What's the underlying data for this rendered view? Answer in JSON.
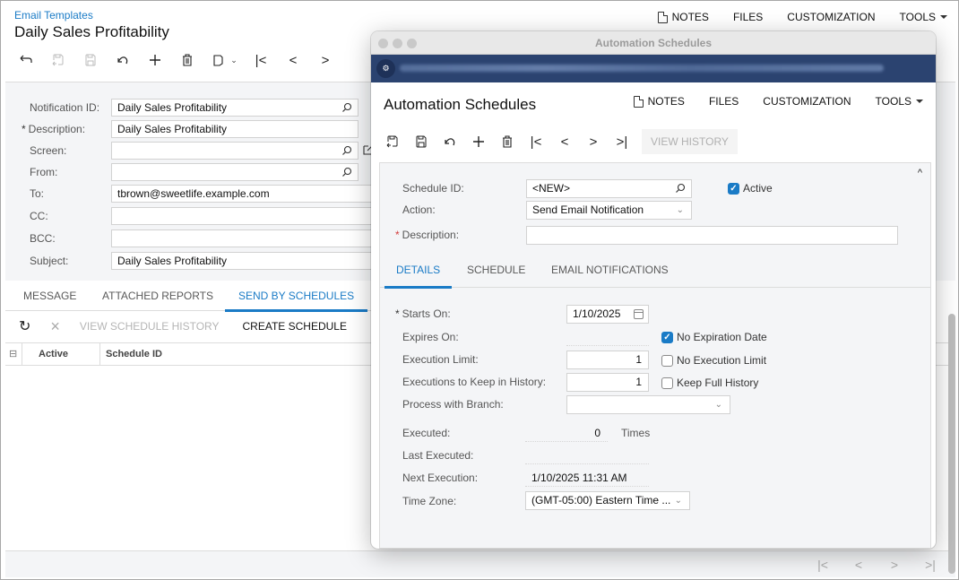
{
  "main": {
    "breadcrumb": "Email Templates",
    "title": "Daily Sales Profitability",
    "top_links": {
      "notes": "NOTES",
      "files": "FILES",
      "customization": "CUSTOMIZATION",
      "tools": "TOOLS"
    },
    "toolbar": [
      {
        "icon": "back-icon",
        "glyph": "↩",
        "disabled": false
      },
      {
        "icon": "save-close-icon",
        "disabled": true
      },
      {
        "icon": "save-icon",
        "disabled": true
      },
      {
        "icon": "undo-icon",
        "glyph": "↶",
        "disabled": false
      },
      {
        "icon": "add-icon",
        "glyph": "+",
        "disabled": false
      },
      {
        "icon": "delete-icon",
        "disabled": false
      },
      {
        "icon": "copy-paste-icon",
        "disabled": false
      },
      {
        "icon": "first-record-icon",
        "glyph": "|<",
        "disabled": false
      },
      {
        "icon": "previous-record-icon",
        "glyph": "<",
        "disabled": false
      },
      {
        "icon": "next-record-icon",
        "glyph": ">",
        "disabled": false
      }
    ],
    "form": {
      "notification_id": {
        "label": "Notification ID:",
        "value": "Daily Sales Profitability"
      },
      "description": {
        "label": "Description:",
        "value": "Daily Sales Profitability",
        "required": "*"
      },
      "screen": {
        "label": "Screen:",
        "value": ""
      },
      "from": {
        "label": "From:",
        "value": ""
      },
      "to": {
        "label": "To:",
        "value": "tbrown@sweetlife.example.com"
      },
      "cc": {
        "label": "CC:",
        "value": ""
      },
      "bcc": {
        "label": "BCC:",
        "value": ""
      },
      "subject": {
        "label": "Subject:",
        "value": "Daily Sales Profitability"
      }
    },
    "tabs": [
      "MESSAGE",
      "ATTACHED REPORTS",
      "SEND BY SCHEDULES"
    ],
    "active_tab": "SEND BY SCHEDULES",
    "grid_toolbar": {
      "refresh": "↻",
      "delete": "×",
      "view_schedule_history": "VIEW SCHEDULE HISTORY",
      "create_schedule": "CREATE SCHEDULE"
    },
    "grid_columns": [
      "Active",
      "Schedule ID"
    ],
    "pager": [
      "|<",
      "<",
      ">",
      ">|"
    ]
  },
  "popup": {
    "window_title": "Automation Schedules",
    "page_title": "Automation Schedules",
    "top_links": {
      "notes": "NOTES",
      "files": "FILES",
      "customization": "CUSTOMIZATION",
      "tools": "TOOLS"
    },
    "toolbar": {
      "view_history": "VIEW HISTORY"
    },
    "form": {
      "schedule_id": {
        "label": "Schedule ID:",
        "value": "<NEW>"
      },
      "active": {
        "label": "Active",
        "checked": true
      },
      "action": {
        "label": "Action:",
        "value": "Send Email Notification"
      },
      "description": {
        "label": "Description:",
        "value": "",
        "required": "*"
      }
    },
    "tabs": [
      "DETAILS",
      "SCHEDULE",
      "EMAIL NOTIFICATIONS"
    ],
    "active_tab": "DETAILS",
    "details": {
      "starts_on": {
        "label": "Starts On:",
        "value": "1/10/2025",
        "required": "*"
      },
      "expires_on": {
        "label": "Expires On:",
        "value": ""
      },
      "no_expiration_date": {
        "label": "No Expiration Date",
        "checked": true
      },
      "execution_limit": {
        "label": "Execution Limit:",
        "value": "1"
      },
      "no_execution_limit": {
        "label": "No Execution Limit",
        "checked": false
      },
      "executions_to_keep": {
        "label": "Executions to Keep in History:",
        "value": "1"
      },
      "keep_full_history": {
        "label": "Keep Full History",
        "checked": false
      },
      "process_with_branch": {
        "label": "Process with Branch:",
        "value": ""
      },
      "executed": {
        "label": "Executed:",
        "value": "0",
        "suffix": "Times"
      },
      "last_executed": {
        "label": "Last Executed:",
        "value": ""
      },
      "next_execution": {
        "label": "Next Execution:",
        "value": "1/10/2025 11:31 AM"
      },
      "time_zone": {
        "label": "Time Zone:",
        "value": "(GMT-05:00) Eastern Time ..."
      }
    }
  },
  "colors": {
    "accent": "#1a7bc6",
    "url_bar": "#2b4370",
    "panel_bg": "#f4f5f7",
    "required_red": "#d43c3c"
  }
}
